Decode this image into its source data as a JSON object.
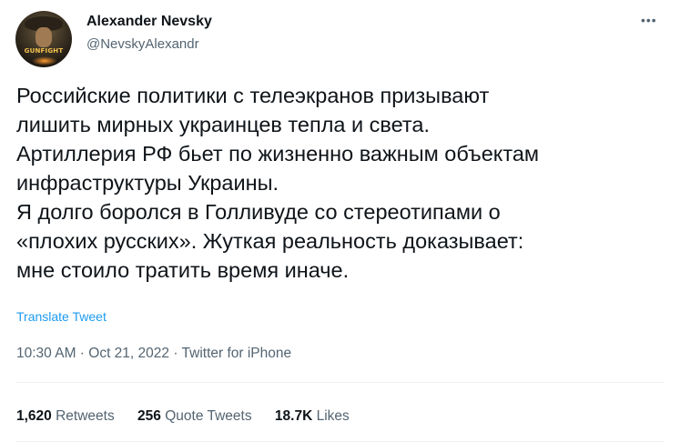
{
  "author": {
    "name": "Alexander Nevsky",
    "handle": "@NevskyAlexandr",
    "avatar_text": "GUNFIGHT"
  },
  "tweet": {
    "lines": [
      "Российские политики с телеэкранов призывают",
      "лишить мирных украинцев тепла и света.",
      "Артиллерия РФ бьет по жизненно важным объектам",
      "инфраструктуры Украины.",
      "Я долго боролся в Голливуде со стереотипами о",
      "«плохих русских». Жуткая реальность доказывает:",
      "мне стоило тратить время иначе."
    ],
    "translate_label": "Translate Tweet",
    "meta": "10:30 AM · Oct 21, 2022 · Twitter for iPhone"
  },
  "stats": {
    "retweets_count": "1,620",
    "retweets_label": "Retweets",
    "quotes_count": "256",
    "quotes_label": "Quote Tweets",
    "likes_count": "18.7K",
    "likes_label": "Likes"
  },
  "more_icon": "more-dots-icon",
  "colors": {
    "link": "#1d9bf0",
    "secondary_text": "#536471",
    "primary_text": "#0f1419"
  }
}
